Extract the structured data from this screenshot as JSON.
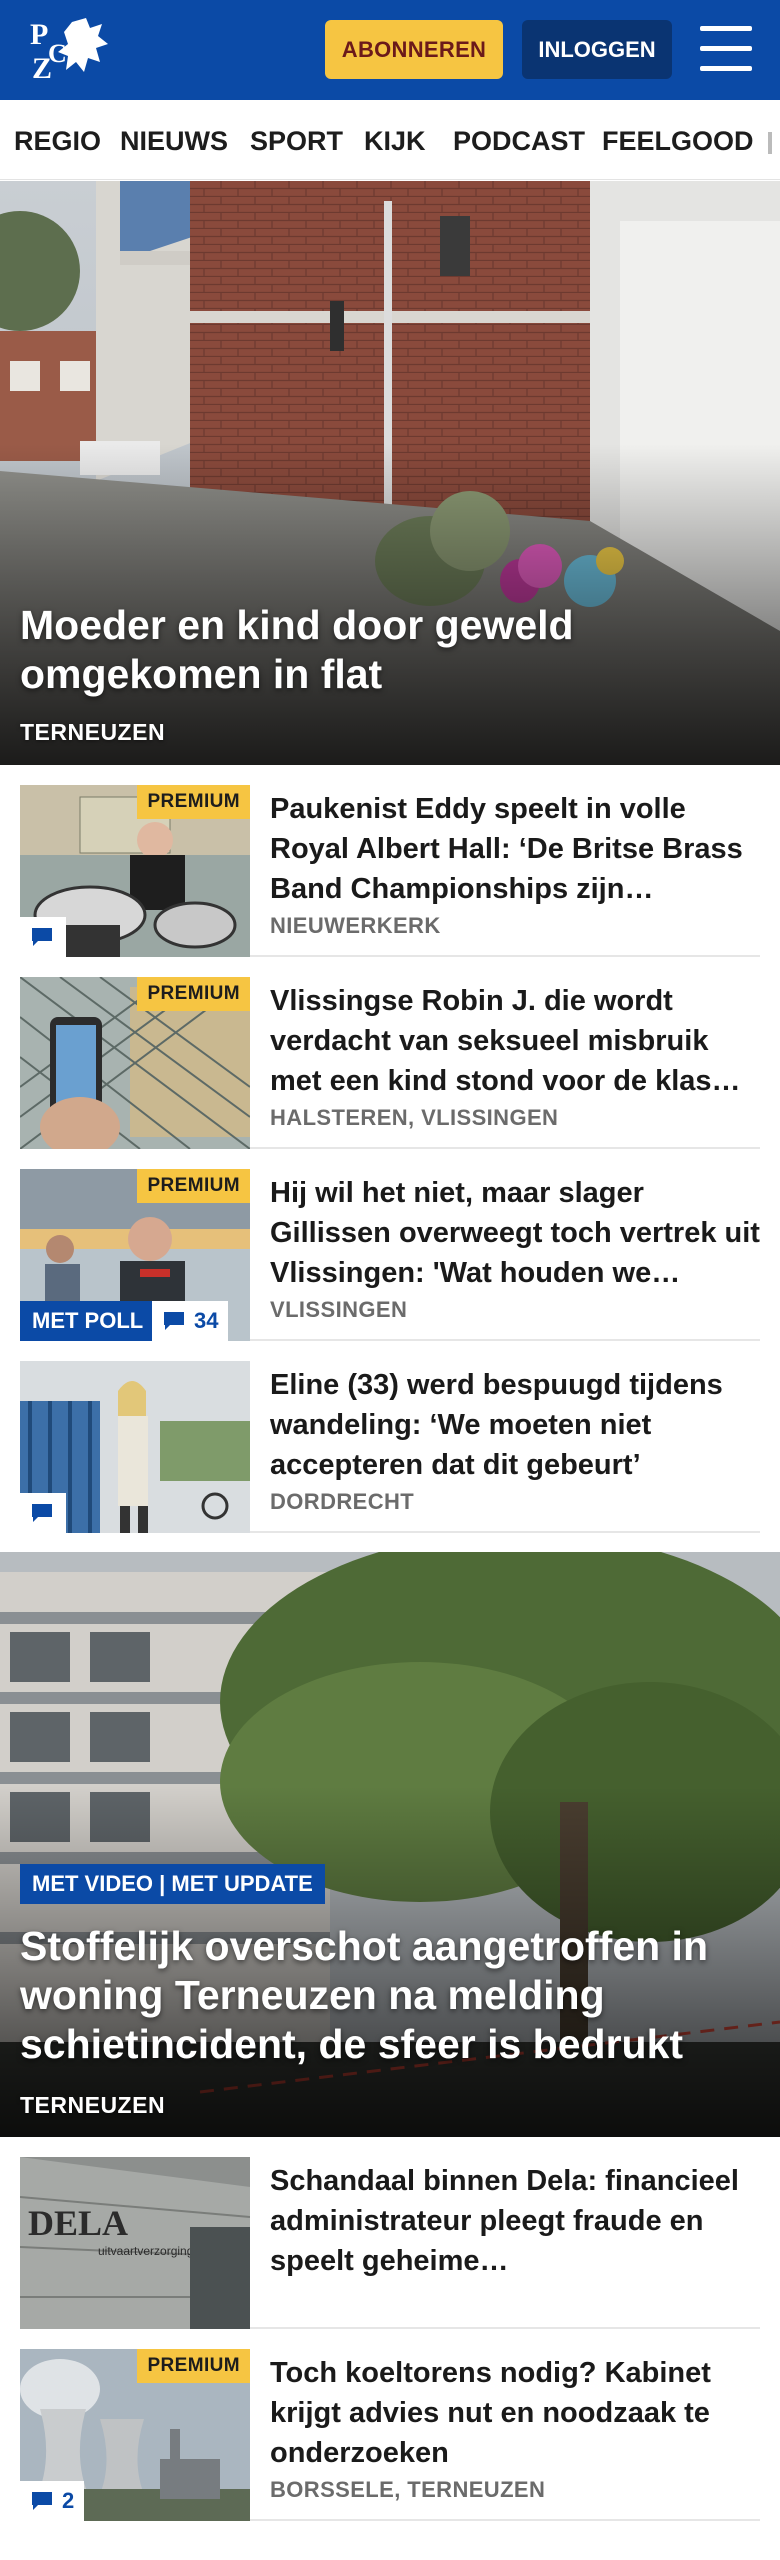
{
  "header": {
    "subscribe_label": "ABONNEREN",
    "login_label": "INLOGGEN",
    "logo_text": "PZC"
  },
  "nav": {
    "items": [
      "REGIO",
      "NIEUWS",
      "SPORT",
      "KIJK",
      "PODCAST",
      "FEELGOOD"
    ]
  },
  "hero1": {
    "title": "Moeder en kind door geweld omgekomen in flat",
    "location": "TERNEUZEN"
  },
  "articles1": [
    {
      "premium": "PREMIUM",
      "title": "Paukenist Eddy speelt in volle Royal Albert Hall: ‘De Britse Brass Band Championships zijn…",
      "location": "NIEUWERKERK",
      "comments": ""
    },
    {
      "premium": "PREMIUM",
      "title": "Vlissingse Robin J. die wordt verdacht van seksueel misbruik met een kind stond voor de klas…",
      "location": "HALSTEREN, VLISSINGEN"
    },
    {
      "premium": "PREMIUM",
      "title": "Hij wil het niet, maar slager Gillissen overweegt toch vertrek uit Vlissingen: 'Wat houden we…",
      "location": "VLISSINGEN",
      "poll": "MET POLL",
      "comments": "34"
    },
    {
      "title": "Eline (33) werd bespuugd tijdens wandeling: ‘We moeten niet accepteren dat dit gebeurt’",
      "location": "DORDRECHT",
      "comments": ""
    }
  ],
  "hero2": {
    "badge": "MET VIDEO | MET UPDATE",
    "title": "Stoffelijk overschot aangetroffen in woning Terneuzen na melding schietincident, de sfeer is bedrukt",
    "location": "TERNEUZEN"
  },
  "articles2": [
    {
      "title": "Schandaal binnen Dela: financieel administrateur pleegt fraude en speelt geheime…",
      "thumb_text": "DELA",
      "thumb_subtext": "uitvaartverzorging"
    },
    {
      "premium": "PREMIUM",
      "title": "Toch koeltorens nodig? Kabinet krijgt advies nut en noodzaak te onderzoeken",
      "location": "BORSSELE, TERNEUZEN",
      "comments": "2"
    }
  ],
  "colors": {
    "brand_blue": "#0b4aa6",
    "navy": "#0a3472",
    "premium_yellow": "#f6c542",
    "location_grey": "#6b6b6b"
  }
}
